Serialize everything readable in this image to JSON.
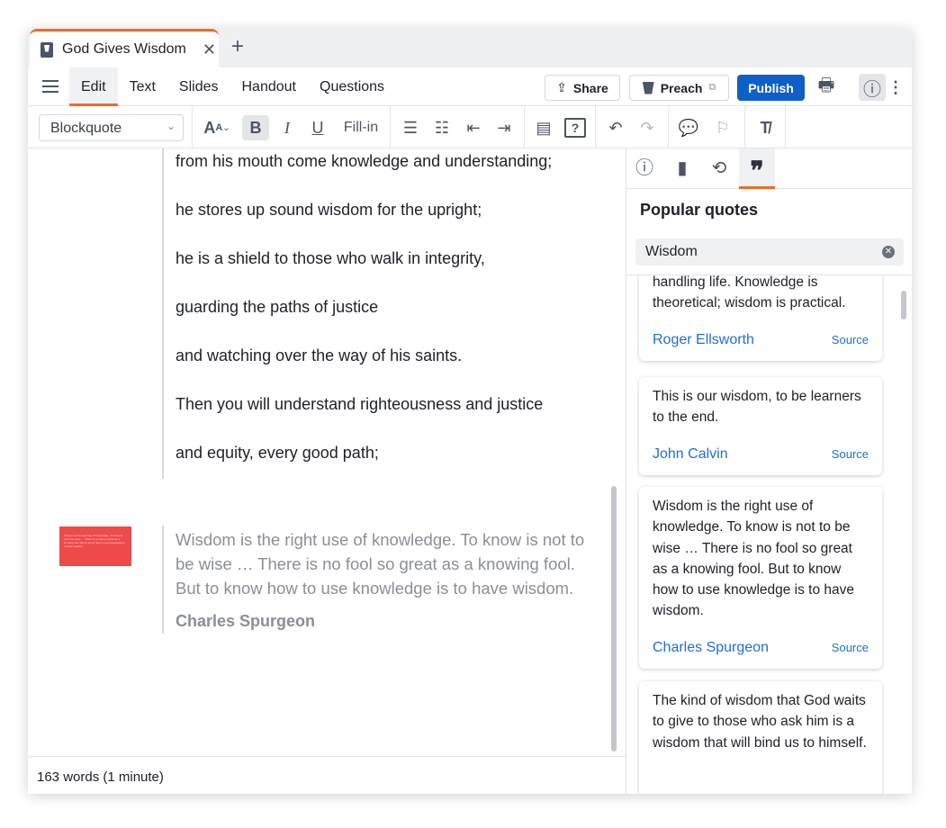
{
  "tab": {
    "title": "God Gives Wisdom"
  },
  "menu": {
    "items": [
      "Edit",
      "Text",
      "Slides",
      "Handout",
      "Questions"
    ],
    "active": "Edit"
  },
  "actions": {
    "share": "Share",
    "preach": "Preach",
    "publish": "Publish"
  },
  "toolbar": {
    "block_style": "Blockquote",
    "fill_in": "Fill-in"
  },
  "editor": {
    "lines": [
      "from his mouth come knowledge and understanding;",
      "he stores up sound wisdom for the upright;",
      "he is a shield to those who walk in integrity,",
      "guarding the paths of justice",
      "and watching over the way of his saints.",
      "Then you will understand righteousness and justice",
      "and equity, every good path;"
    ],
    "blockquote": {
      "text": "Wisdom is the right use of knowledge. To know is not to be wise … There is no fool so great as a knowing fool. But to know how to use knowledge is to have wisdom.",
      "author": "Charles Spurgeon"
    }
  },
  "footer": {
    "word_count": "163 words (1 minute)"
  },
  "sidebar": {
    "title": "Popular quotes",
    "search_value": "Wisdom",
    "source_label": "Source",
    "quotes": [
      {
        "text": "handling life. Knowledge is theoretical; wisdom is practical.",
        "author": "Roger Ellsworth"
      },
      {
        "text": "This is our wisdom, to be learners to the end.",
        "author": "John Calvin"
      },
      {
        "text": "Wisdom is the right use of knowledge. To know is not to be wise … There is no fool so great as a knowing fool. But to know how to use knowledge is to have wisdom.",
        "author": "Charles Spurgeon"
      },
      {
        "text": "The kind of wisdom that God waits to give to those who ask him is a wisdom that will bind us to himself.",
        "author": ""
      }
    ]
  },
  "colors": {
    "accent": "#f26a21",
    "primary": "#0f5fc8",
    "link": "#1f6fd1",
    "thumbnail": "#ef4a4a"
  }
}
